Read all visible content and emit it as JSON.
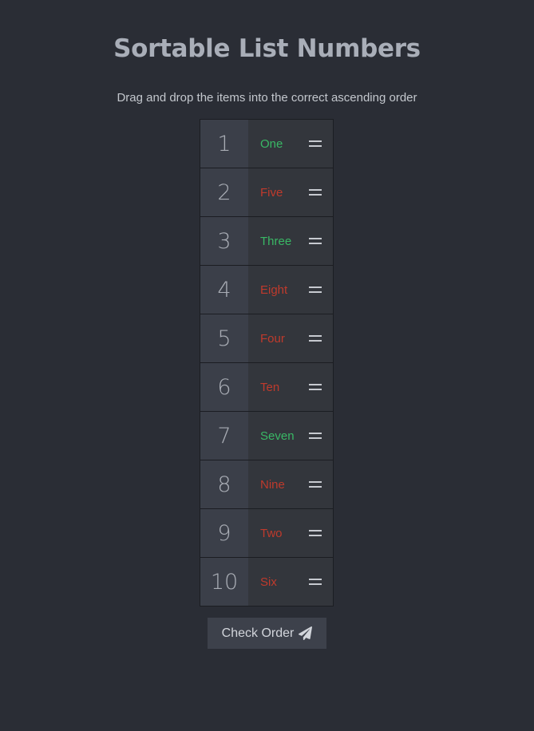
{
  "page": {
    "title": "Sortable List Numbers",
    "subtitle": "Drag and drop the items into the correct ascending order"
  },
  "list": {
    "items": [
      {
        "rank": "1",
        "word": "One",
        "status": "correct"
      },
      {
        "rank": "2",
        "word": "Five",
        "status": "wrong"
      },
      {
        "rank": "3",
        "word": "Three",
        "status": "correct"
      },
      {
        "rank": "4",
        "word": "Eight",
        "status": "wrong"
      },
      {
        "rank": "5",
        "word": "Four",
        "status": "wrong"
      },
      {
        "rank": "6",
        "word": "Ten",
        "status": "wrong"
      },
      {
        "rank": "7",
        "word": "Seven",
        "status": "correct"
      },
      {
        "rank": "8",
        "word": "Nine",
        "status": "wrong"
      },
      {
        "rank": "9",
        "word": "Two",
        "status": "wrong"
      },
      {
        "rank": "10",
        "word": "Six",
        "status": "wrong"
      }
    ],
    "grip_icon": "grip-lines-icon"
  },
  "button": {
    "label": "Check Order",
    "icon": "paper-plane-icon"
  },
  "colors": {
    "background": "#2a2d35",
    "correct": "#39b865",
    "wrong": "#bf3a2c",
    "number_cell": "#3b3f49",
    "item_cell": "#33363c",
    "button": "#3d414b"
  }
}
